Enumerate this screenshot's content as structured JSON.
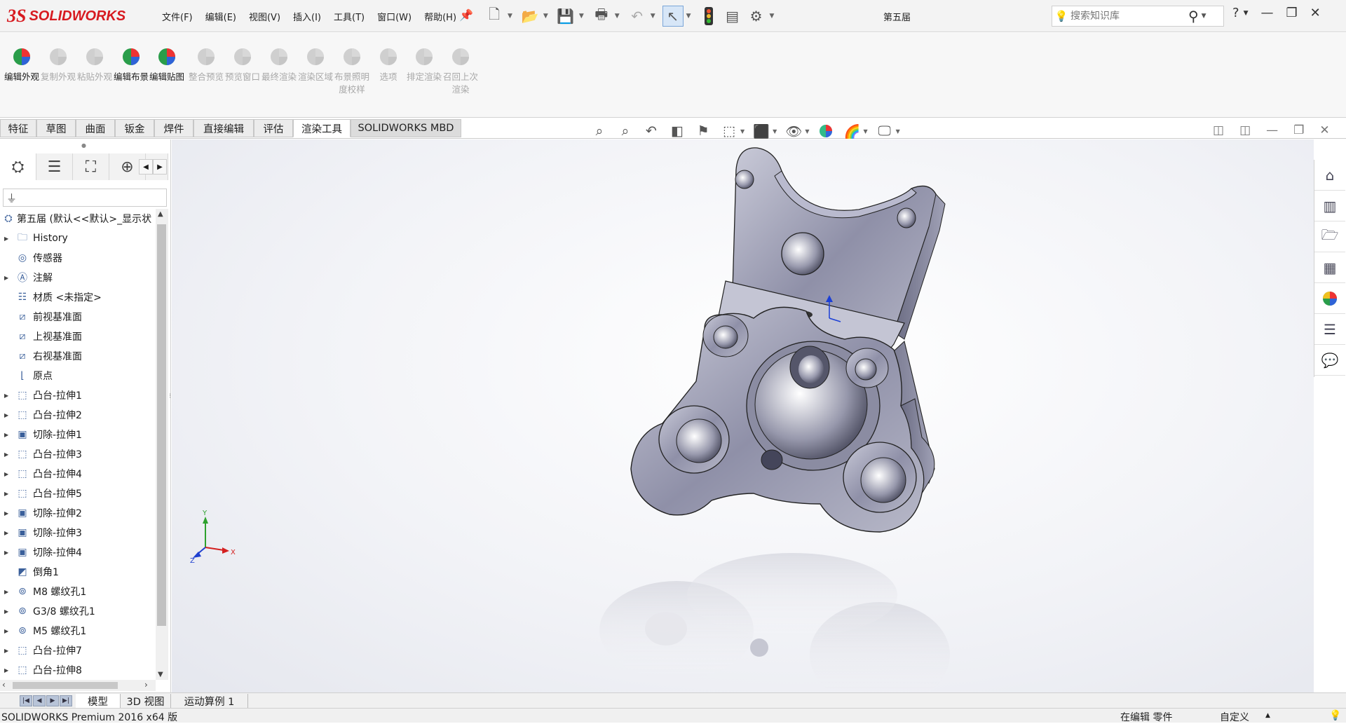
{
  "app": {
    "logo_prefix": "3S",
    "logo_text": "SOLIDWORKS",
    "brand_color": "#d71a20"
  },
  "menu": [
    "文件(F)",
    "编辑(E)",
    "视图(V)",
    "插入(I)",
    "工具(T)",
    "窗口(W)",
    "帮助(H)"
  ],
  "document_title": "第五届",
  "search": {
    "placeholder": "搜索知识库"
  },
  "ribbon_buttons": [
    {
      "label": "编辑外观",
      "enabled": true,
      "icon": "edit-appearance-icon"
    },
    {
      "label": "复制外观",
      "enabled": false,
      "icon": "copy-appearance-icon"
    },
    {
      "label": "粘贴外观",
      "enabled": false,
      "icon": "paste-appearance-icon"
    },
    {
      "label": "编辑布景",
      "enabled": true,
      "icon": "edit-scene-icon"
    },
    {
      "label": "编辑贴图",
      "enabled": true,
      "icon": "edit-decal-icon"
    },
    {
      "label": "整合预览",
      "enabled": false,
      "icon": "integrated-preview-icon"
    },
    {
      "label": "预览窗口",
      "enabled": false,
      "icon": "preview-window-icon"
    },
    {
      "label": "最终渲染",
      "enabled": false,
      "icon": "final-render-icon"
    },
    {
      "label": "渲染区域",
      "enabled": false,
      "icon": "render-region-icon"
    },
    {
      "label": "布景照明度校样",
      "enabled": false,
      "icon": "scene-illumination-icon"
    },
    {
      "label": "选项",
      "enabled": false,
      "icon": "options-icon"
    },
    {
      "label": "排定渲染",
      "enabled": false,
      "icon": "schedule-render-icon"
    },
    {
      "label": "召回上次渲染",
      "enabled": false,
      "icon": "recall-render-icon"
    }
  ],
  "command_tabs": [
    "特征",
    "草图",
    "曲面",
    "钣金",
    "焊件",
    "直接编辑",
    "评估",
    "渲染工具",
    "SOLIDWORKS MBD"
  ],
  "active_command_tab": "渲染工具",
  "tree": {
    "root": "第五届 (默认<<默认>_显示状",
    "items": [
      {
        "label": "History",
        "icon": "history-folder-icon",
        "expandable": true
      },
      {
        "label": "传感器",
        "icon": "sensor-icon",
        "expandable": false
      },
      {
        "label": "注解",
        "icon": "annotation-icon",
        "expandable": true
      },
      {
        "label": "材质 <未指定>",
        "icon": "material-icon",
        "expandable": false
      },
      {
        "label": "前视基准面",
        "icon": "plane-icon",
        "expandable": false
      },
      {
        "label": "上视基准面",
        "icon": "plane-icon",
        "expandable": false
      },
      {
        "label": "右视基准面",
        "icon": "plane-icon",
        "expandable": false
      },
      {
        "label": "原点",
        "icon": "origin-icon",
        "expandable": false
      },
      {
        "label": "凸台-拉伸1",
        "icon": "boss-extrude-icon",
        "expandable": true
      },
      {
        "label": "凸台-拉伸2",
        "icon": "boss-extrude-icon",
        "expandable": true
      },
      {
        "label": "切除-拉伸1",
        "icon": "cut-extrude-icon",
        "expandable": true
      },
      {
        "label": "凸台-拉伸3",
        "icon": "boss-extrude-icon",
        "expandable": true
      },
      {
        "label": "凸台-拉伸4",
        "icon": "boss-extrude-icon",
        "expandable": true
      },
      {
        "label": "凸台-拉伸5",
        "icon": "boss-extrude-icon",
        "expandable": true
      },
      {
        "label": "切除-拉伸2",
        "icon": "cut-extrude-icon",
        "expandable": true
      },
      {
        "label": "切除-拉伸3",
        "icon": "cut-extrude-icon",
        "expandable": true
      },
      {
        "label": "切除-拉伸4",
        "icon": "cut-extrude-icon",
        "expandable": true
      },
      {
        "label": "倒角1",
        "icon": "chamfer-icon",
        "expandable": false
      },
      {
        "label": "M8 螺纹孔1",
        "icon": "hole-icon",
        "expandable": true
      },
      {
        "label": "G3/8 螺纹孔1",
        "icon": "hole-icon",
        "expandable": true
      },
      {
        "label": "M5 螺纹孔1",
        "icon": "hole-icon",
        "expandable": true
      },
      {
        "label": "凸台-拉伸7",
        "icon": "boss-extrude-icon",
        "expandable": true
      },
      {
        "label": "凸台-拉伸8",
        "icon": "boss-extrude-icon",
        "expandable": true
      }
    ]
  },
  "bottom_tabs": [
    "模型",
    "3D 视图",
    "运动算例 1"
  ],
  "active_bottom_tab": "模型",
  "status": {
    "left": "SOLIDWORKS Premium 2016 x64 版",
    "mode": "在编辑 零件",
    "units": "自定义"
  },
  "colors": {
    "part": "#9a9bb0",
    "accent": "#1f6fd0",
    "tab_active": "#ffffff"
  }
}
